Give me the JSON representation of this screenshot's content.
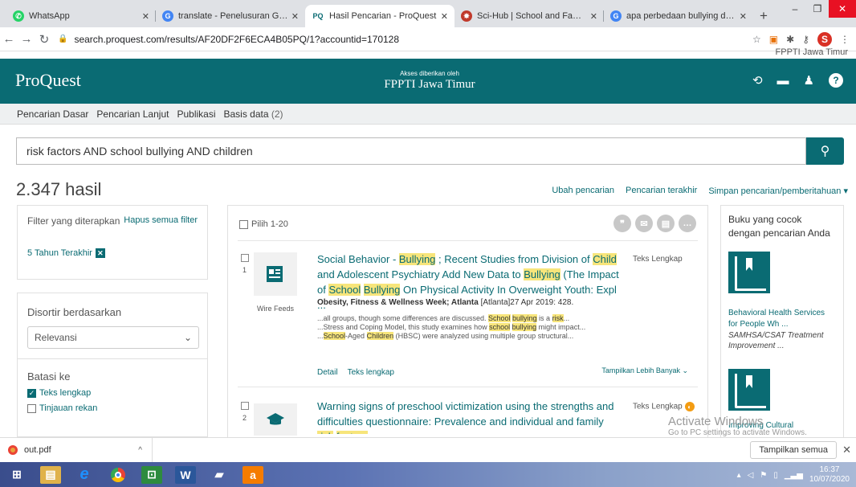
{
  "browser": {
    "tabs": [
      {
        "label": "WhatsApp",
        "icon_color": "#25d366",
        "icon_glyph": "W"
      },
      {
        "label": "translate - Penelusuran Google",
        "icon_color": "#4285f4",
        "icon_glyph": "G"
      },
      {
        "label": "Hasil Pencarian - ProQuest",
        "icon_color": "#0a6b73",
        "icon_glyph": "PQ"
      },
      {
        "label": "Sci-Hub | School and Family Fac",
        "icon_color": "#c0392b",
        "icon_glyph": "S"
      },
      {
        "label": "apa perbedaan bullying dengan",
        "icon_color": "#4285f4",
        "icon_glyph": "G"
      }
    ],
    "url": "search.proquest.com/results/AF20DF2F6ECA4B05PQ/1?accountid=170128",
    "profile_initial": "S"
  },
  "header": {
    "fppti_top": "FPPTI Jawa Timur",
    "logo": "ProQuest",
    "access_small": "Akses diberikan oleh",
    "access_big": "FPPTI Jawa Timur"
  },
  "subnav": {
    "items": [
      "Pencarian Dasar",
      "Pencarian Lanjut",
      "Publikasi",
      "Basis data"
    ],
    "db_count": "(2)"
  },
  "search": {
    "query": "risk factors AND school bullying AND children"
  },
  "results": {
    "count": "2.347 hasil",
    "links": [
      "Ubah pencarian",
      "Pencarian terakhir",
      "Simpan pencarian/pemberitahuan ▾"
    ],
    "select_label": "Pilih 1-20",
    "items": [
      {
        "num": "1",
        "type": "Wire Feeds",
        "fulltext": "Teks Lengkap",
        "pub": "Obesity, Fitness & Wellness Week; Atlanta",
        "pub_rest": " [Atlanta]27 Apr 2019: 428.",
        "detail": "Detail",
        "teks": "Teks lengkap",
        "more": "Tampilkan Lebih Banyak ⌄"
      },
      {
        "num": "2",
        "fulltext": "Teks Lengkap"
      }
    ]
  },
  "filters": {
    "title": "Filter yang diterapkan",
    "clear": "Hapus semua filter",
    "chip": "5 Tahun Terakhir",
    "sort_label": "Disortir berdasarkan",
    "sort_value": "Relevansi",
    "limit_label": "Batasi ke",
    "opt1": "Teks lengkap",
    "opt2": "Tinjauan rekan"
  },
  "sidebar_right": {
    "title": "Buku yang cocok dengan pencarian Anda",
    "book1_title": "Behavioral Health Services for People Wh ...",
    "book1_sub": "SAMHSA/CSAT Treatment Improvement ...",
    "book2_title": "Improving Cultural"
  },
  "watermark": {
    "line1": "Activate Windows",
    "line2": "Go to PC settings to activate Windows."
  },
  "downloads": {
    "file": "out.pdf",
    "show_all": "Tampilkan semua"
  },
  "taskbar": {
    "time": "16:37",
    "date": "10/07/2020"
  }
}
